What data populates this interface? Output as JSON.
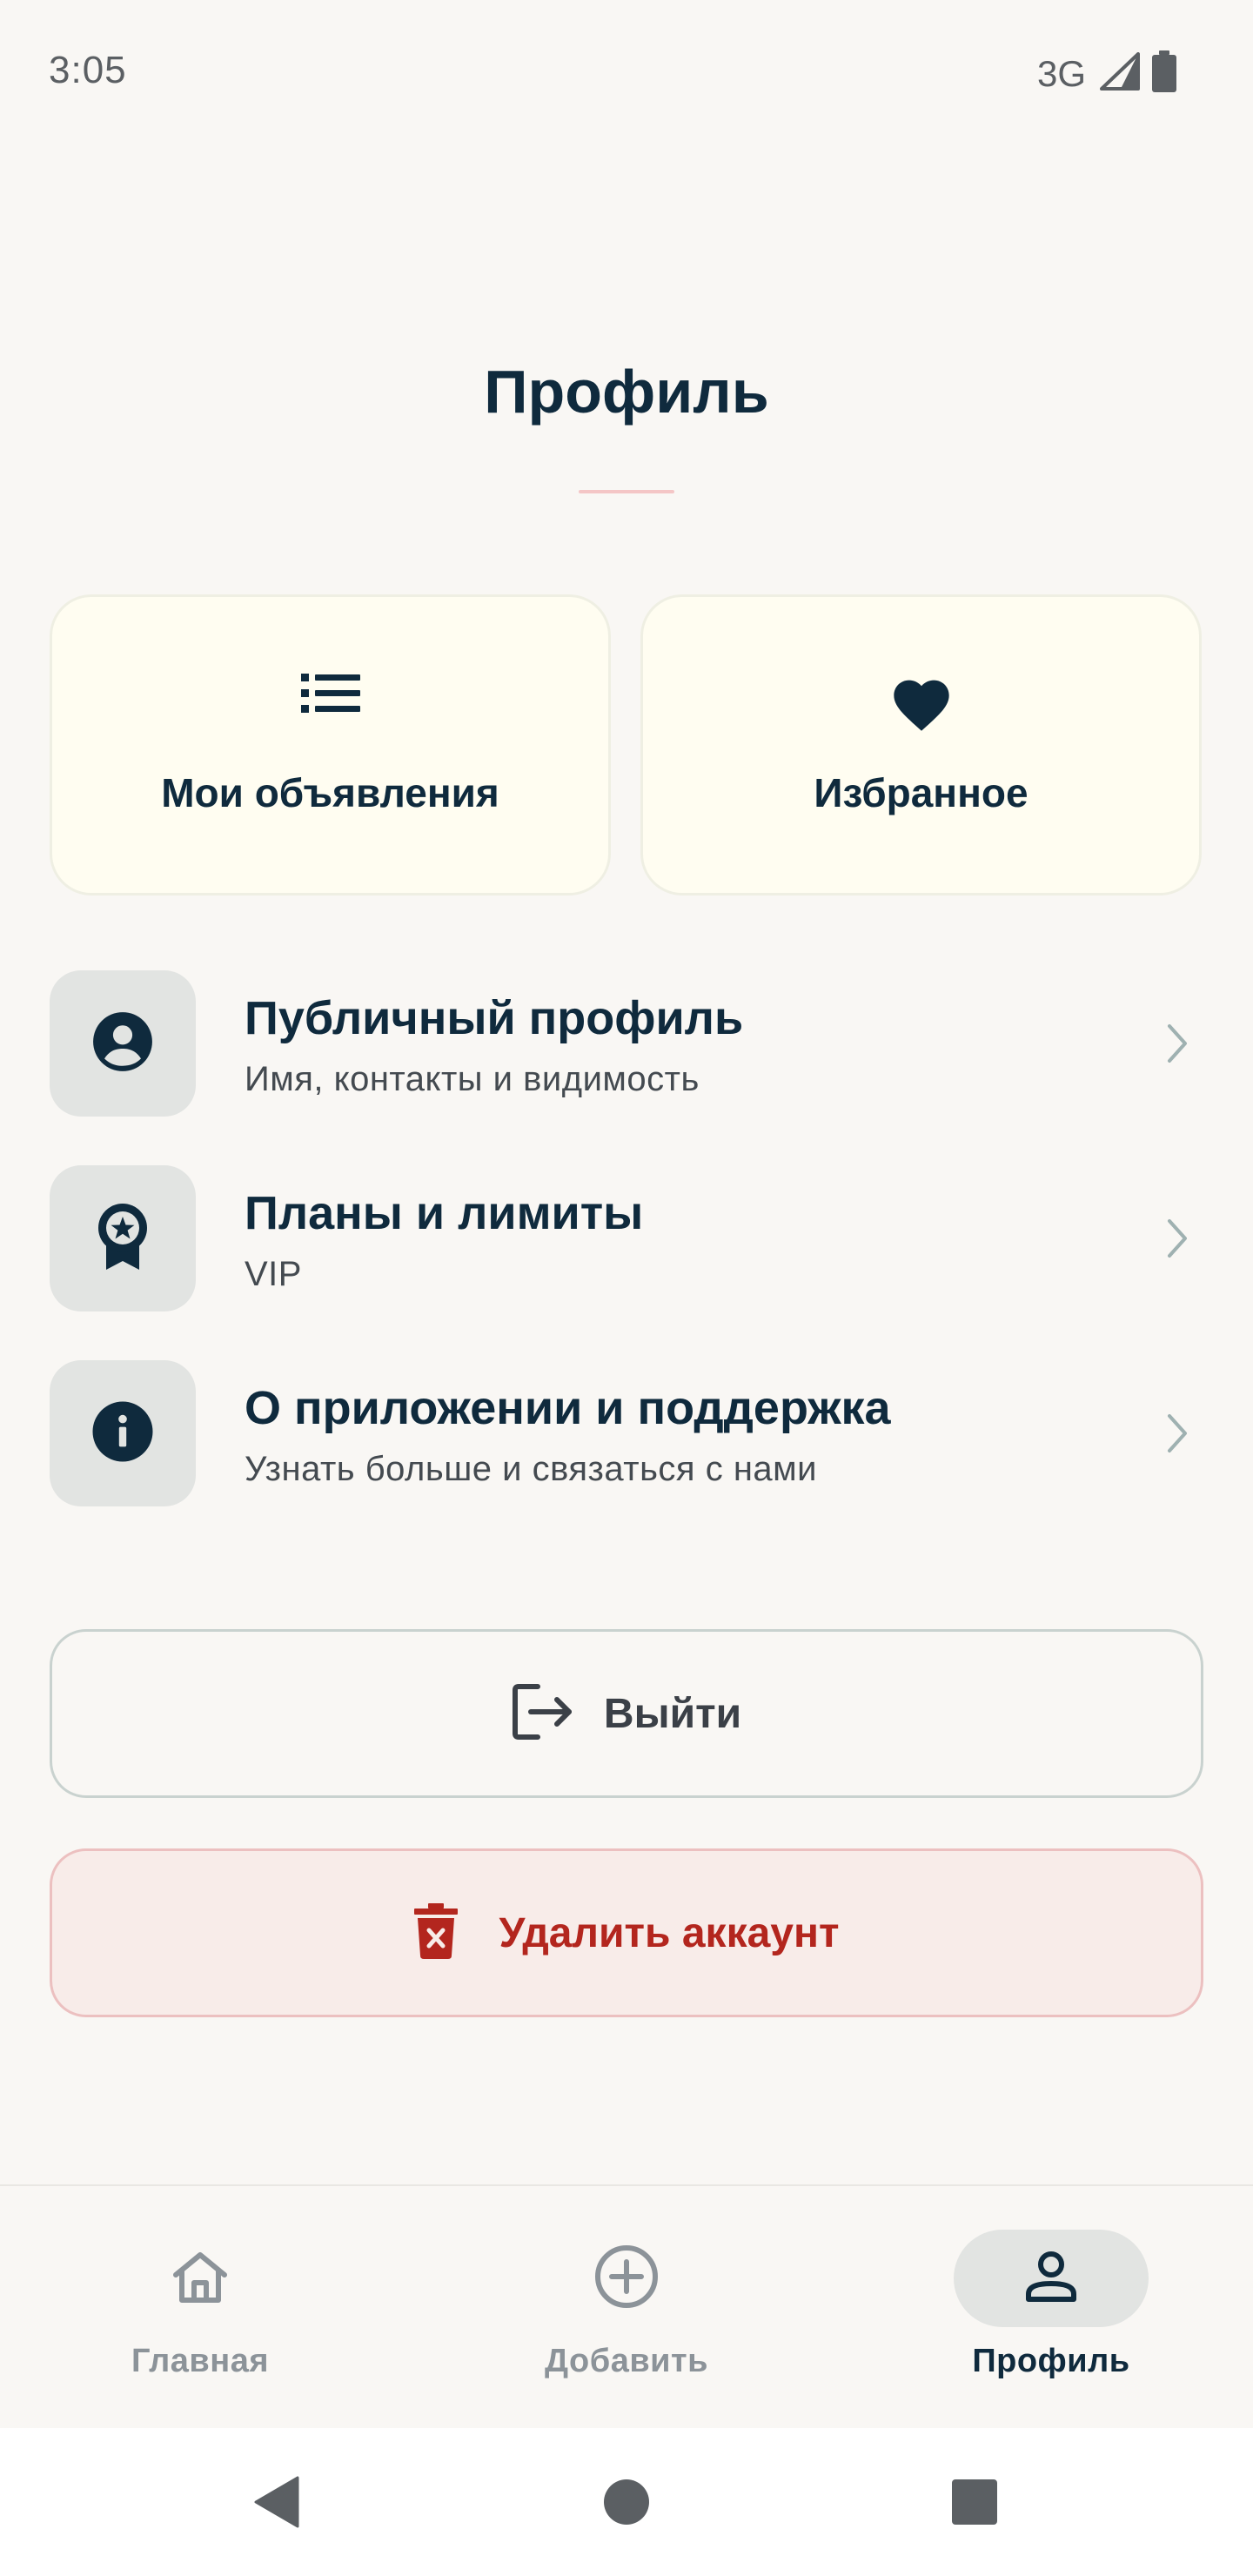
{
  "status_bar": {
    "time": "3:05",
    "network": "3G"
  },
  "header": {
    "title": "Профиль"
  },
  "quick_cards": [
    {
      "label": "Мои объявления",
      "icon": "list-icon"
    },
    {
      "label": "Избранное",
      "icon": "heart-icon"
    }
  ],
  "menu": [
    {
      "title": "Публичный профиль",
      "subtitle": "Имя, контакты и видимость",
      "icon": "account-circle-icon"
    },
    {
      "title": "Планы и лимиты",
      "subtitle": "VIP",
      "icon": "award-badge-icon"
    },
    {
      "title": "О приложении и поддержка",
      "subtitle": "Узнать больше и связаться с нами",
      "icon": "info-icon"
    }
  ],
  "actions": {
    "logout_label": "Выйти",
    "delete_label": "Удалить аккаунт"
  },
  "bottom_nav": [
    {
      "label": "Главная",
      "icon": "home-icon",
      "active": false
    },
    {
      "label": "Добавить",
      "icon": "add-circle-icon",
      "active": false
    },
    {
      "label": "Профиль",
      "icon": "person-icon",
      "active": true
    }
  ],
  "colors": {
    "background": "#f9f7f4",
    "primary_text": "#0f2a3d",
    "card_background": "#fffdf1",
    "danger": "#b3261e",
    "danger_background": "#f8ece9",
    "icon_box": "#e2e4e2"
  }
}
